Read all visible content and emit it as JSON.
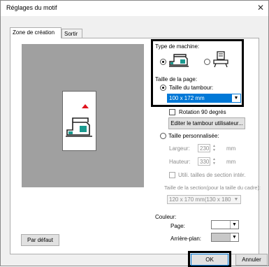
{
  "window": {
    "title": "Réglages du motif",
    "close_glyph": "✕"
  },
  "tabs": [
    {
      "label": "Zone de création",
      "active": true
    },
    {
      "label": "Sortir",
      "active": false
    }
  ],
  "machine": {
    "label": "Type de machine:",
    "options": [
      {
        "name": "embroidery-machine",
        "selected": true
      },
      {
        "name": "other-machine",
        "selected": false
      }
    ]
  },
  "page_size": {
    "label": "Taille de la page:",
    "hoop_radio_label": "Taille du tambour:",
    "hoop_selected": true,
    "hoop_value": "100 x 172 mm",
    "rotate_label": "Rotation 90 degrés",
    "edit_hoop_button": "Editer le tambour utilisateur...",
    "custom_radio_label": "Taille personnalisée:",
    "width_label": "Largeur:",
    "width_value": "230",
    "height_label": "Hauteur:",
    "height_value": "330",
    "unit": "mm",
    "section_check_label": "Utili. tailles de section intér.",
    "section_size_label": "Taille de la section(pour la taille du cadre):",
    "section_size_value": "120 x 170 mm(130 x 180 m"
  },
  "color": {
    "label": "Couleur:",
    "page_label": "Page:",
    "background_label": "Arrière-plan:",
    "page_color": "#ffffff",
    "background_color": "#c8c8c8"
  },
  "buttons": {
    "default": "Par défaut",
    "ok": "OK",
    "cancel": "Annuler"
  },
  "accent": {
    "selection": "#0078d7",
    "hoop_marker": "#e0141e",
    "highlight": "#000000"
  }
}
